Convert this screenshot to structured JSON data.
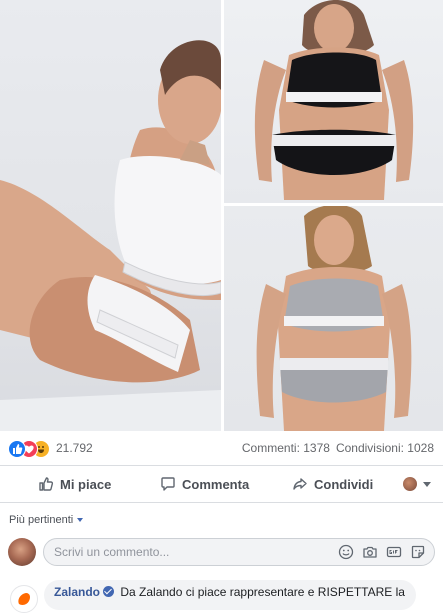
{
  "post": {
    "images": [
      {
        "name": "main-photo",
        "icon": "model-white-underwear-image"
      },
      {
        "name": "top-right-photo",
        "icon": "model-black-underwear-image"
      },
      {
        "name": "bottom-right-photo",
        "icon": "model-grey-underwear-image"
      }
    ]
  },
  "stats": {
    "reactions": [
      "like-icon",
      "love-icon",
      "haha-icon"
    ],
    "reaction_count": "21.792",
    "comments": "Commenti: 1378",
    "shares": "Condivisioni: 1028"
  },
  "actions": {
    "like": "Mi piace",
    "comment": "Commenta",
    "share": "Condividi"
  },
  "sort": {
    "label": "Più pertinenti"
  },
  "composer": {
    "placeholder": "Scrivi un commento..."
  },
  "reply": {
    "author": "Zalando",
    "text": "Da Zalando ci piace rappresentare e RISPETTARE la"
  },
  "colors": {
    "accent": "#4267b2",
    "like": "#1877f2",
    "love": "#f33e58",
    "haha": "#f7b125",
    "zalando": "#ff6900"
  }
}
